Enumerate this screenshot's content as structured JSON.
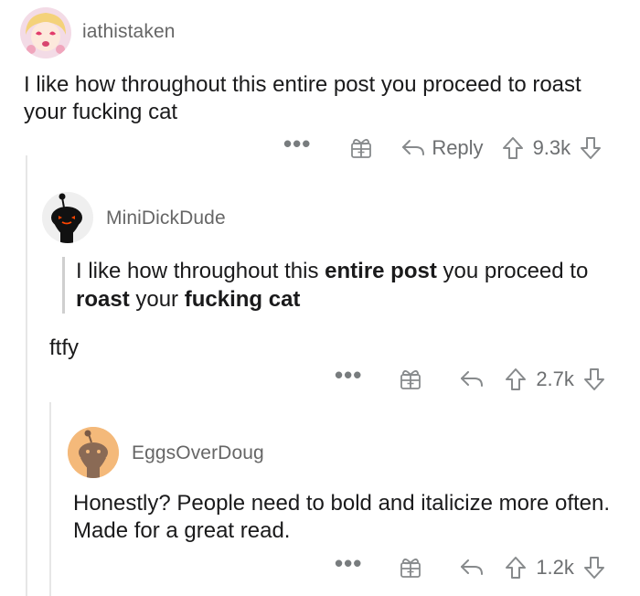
{
  "comments": [
    {
      "username": "iathistaken",
      "body": "I like how throughout this entire post you proceed to roast your fucking cat",
      "actions": {
        "more": "•••",
        "reply_label": "Reply",
        "score": "9.3k"
      }
    },
    {
      "username": "MiniDickDude",
      "quote": [
        {
          "text": "I like how throughout this ",
          "bold": false
        },
        {
          "text": "entire post",
          "bold": true
        },
        {
          "text": " you proceed to ",
          "bold": false
        },
        {
          "text": "roast",
          "bold": true
        },
        {
          "text": " your ",
          "bold": false
        },
        {
          "text": "fucking cat",
          "bold": true
        }
      ],
      "body": "ftfy",
      "actions": {
        "more": "•••",
        "score": "2.7k"
      }
    },
    {
      "username": "EggsOverDoug",
      "body": "Honestly?  People need to bold and italicize more often. Made for a great read.",
      "actions": {
        "more": "•••",
        "score": "1.2k"
      }
    }
  ],
  "colors": {
    "text": "#1a1a1b",
    "muted": "#787c7e",
    "thread_line": "#e6e6e6",
    "avatar2_bg": "#f2f2f2",
    "avatar3_bg": "#f4b97a"
  },
  "icons": [
    "award-icon",
    "reply-icon",
    "upvote-icon",
    "downvote-icon",
    "more-icon"
  ]
}
